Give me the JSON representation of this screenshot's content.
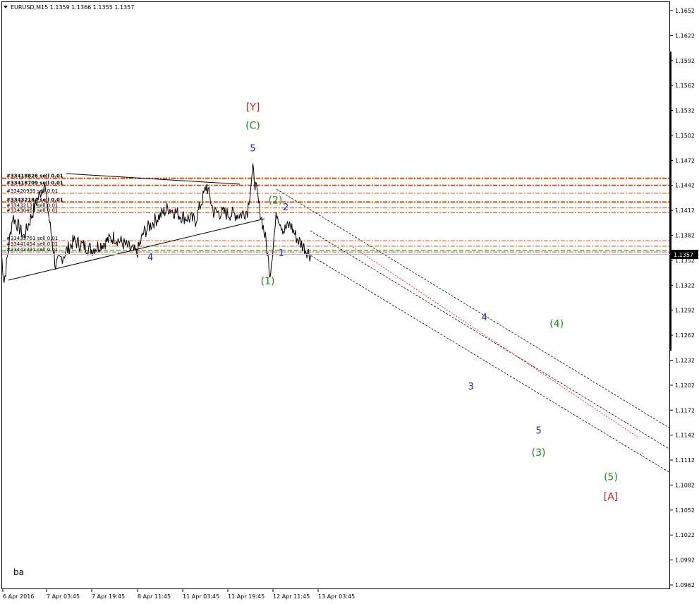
{
  "header": {
    "title": "EURUSD,M15 1.1359 1.1366 1.1355 1.1357"
  },
  "watermark": "ba",
  "price_box": "1.1357",
  "colors": {
    "order_line": "#ff4500",
    "price_line": "#c0c0c0",
    "green_line": "#008000",
    "channel": "#000000",
    "red_channel": "#ff0000",
    "blue_label": "#1f1fd0",
    "green_label": "#1f8a1f",
    "red_label": "#e02020"
  },
  "chart_data": {
    "type": "line",
    "symbol": "EURUSD",
    "timeframe": "M15",
    "ohlc_header": {
      "open": 1.1359,
      "high": 1.1366,
      "low": 1.1355,
      "close": 1.1357
    },
    "x_ticks": [
      "6 Apr 2016",
      "7 Apr 03:45",
      "7 Apr 19:45",
      "8 Apr 11:45",
      "11 Apr 03:45",
      "11 Apr 19:45",
      "12 Apr 11:45",
      "13 Apr 03:45"
    ],
    "y_ticks": [
      "1.1652",
      "1.1622",
      "1.1592",
      "1.1562",
      "1.1532",
      "1.1502",
      "1.1472",
      "1.1442",
      "1.1412",
      "1.1382",
      "1.1352",
      "1.1322",
      "1.1292",
      "1.1262",
      "1.1232",
      "1.1202",
      "1.1172",
      "1.1142",
      "1.1112",
      "1.1082",
      "1.1052",
      "1.1022",
      "1.0992",
      "1.0962"
    ],
    "ylim": [
      1.0962,
      1.1652
    ],
    "current_price": 1.1357,
    "price_keypoints": [
      {
        "x": 0,
        "y": 1.136
      },
      {
        "x": 0.06,
        "y": 1.1326
      },
      {
        "x": 0.25,
        "y": 1.1405
      },
      {
        "x": 0.5,
        "y": 1.138
      },
      {
        "x": 0.75,
        "y": 1.1418
      },
      {
        "x": 0.95,
        "y": 1.1445
      },
      {
        "x": 1.2,
        "y": 1.1345
      },
      {
        "x": 1.6,
        "y": 1.1375
      },
      {
        "x": 2.0,
        "y": 1.1365
      },
      {
        "x": 2.5,
        "y": 1.138
      },
      {
        "x": 3.0,
        "y": 1.136
      },
      {
        "x": 3.15,
        "y": 1.1385
      },
      {
        "x": 3.4,
        "y": 1.14
      },
      {
        "x": 3.7,
        "y": 1.1415
      },
      {
        "x": 4.0,
        "y": 1.1405
      },
      {
        "x": 4.3,
        "y": 1.14
      },
      {
        "x": 4.55,
        "y": 1.1442
      },
      {
        "x": 4.7,
        "y": 1.141
      },
      {
        "x": 5.0,
        "y": 1.1408
      },
      {
        "x": 5.3,
        "y": 1.1407
      },
      {
        "x": 5.45,
        "y": 1.1412
      },
      {
        "x": 5.57,
        "y": 1.146
      },
      {
        "x": 5.7,
        "y": 1.142
      },
      {
        "x": 5.85,
        "y": 1.1378
      },
      {
        "x": 5.95,
        "y": 1.1336
      },
      {
        "x": 6.1,
        "y": 1.141
      },
      {
        "x": 6.25,
        "y": 1.1388
      },
      {
        "x": 6.4,
        "y": 1.1395
      },
      {
        "x": 6.55,
        "y": 1.1378
      },
      {
        "x": 6.7,
        "y": 1.1368
      },
      {
        "x": 6.85,
        "y": 1.1358
      }
    ],
    "orders": [
      {
        "label": "#33418826 sell 0.01",
        "price": 1.14505,
        "style": "bold"
      },
      {
        "label": "#33418709 sell 0.01",
        "price": 1.1442,
        "style": "bold"
      },
      {
        "label": "#33420939 sell 0.01",
        "price": 1.14325,
        "style": "thin"
      },
      {
        "label": "#33432184 sell 0.01",
        "price": 1.1422,
        "style": "bold"
      },
      {
        "label": "#33432131 sell 0.01",
        "price": 1.1415,
        "style": "thin"
      },
      {
        "label": "#33430461 sell 0.01",
        "price": 1.1409,
        "style": "thin"
      },
      {
        "label": "#33435761 sell 0.01",
        "price": 1.13755,
        "style": "thin"
      },
      {
        "label": "#33441454 sell 0.01",
        "price": 1.1369,
        "style": "thin"
      },
      {
        "label": "#33443391 sell 0.01",
        "price": 1.1362,
        "style": "thin"
      }
    ],
    "green_dash_price": 1.1364,
    "wave_labels": [
      {
        "text": "[Y]",
        "x": 5.57,
        "price": 1.1532,
        "color": "red"
      },
      {
        "text": "(C)",
        "x": 5.57,
        "price": 1.151,
        "color": "green"
      },
      {
        "text": "5",
        "x": 5.57,
        "price": 1.1483,
        "color": "blue"
      },
      {
        "text": "4",
        "x": 3.3,
        "price": 1.1352,
        "color": "blue"
      },
      {
        "text": "(2)",
        "x": 6.07,
        "price": 1.142,
        "color": "green"
      },
      {
        "text": "2",
        "x": 6.3,
        "price": 1.1412,
        "color": "blue"
      },
      {
        "text": "1",
        "x": 6.2,
        "price": 1.1357,
        "color": "blue"
      },
      {
        "text": "(1)",
        "x": 5.9,
        "price": 1.1323,
        "color": "green"
      },
      {
        "text": "4",
        "x": 10.7,
        "price": 1.128,
        "color": "blue"
      },
      {
        "text": "(4)",
        "x": 12.3,
        "price": 1.1272,
        "color": "green"
      },
      {
        "text": "3",
        "x": 10.4,
        "price": 1.1197,
        "color": "blue"
      },
      {
        "text": "5",
        "x": 11.9,
        "price": 1.1144,
        "color": "blue"
      },
      {
        "text": "(3)",
        "x": 11.9,
        "price": 1.1117,
        "color": "green"
      },
      {
        "text": "(5)",
        "x": 13.5,
        "price": 1.1088,
        "color": "green"
      },
      {
        "text": "[A]",
        "x": 13.5,
        "price": 1.1064,
        "color": "red"
      }
    ]
  }
}
